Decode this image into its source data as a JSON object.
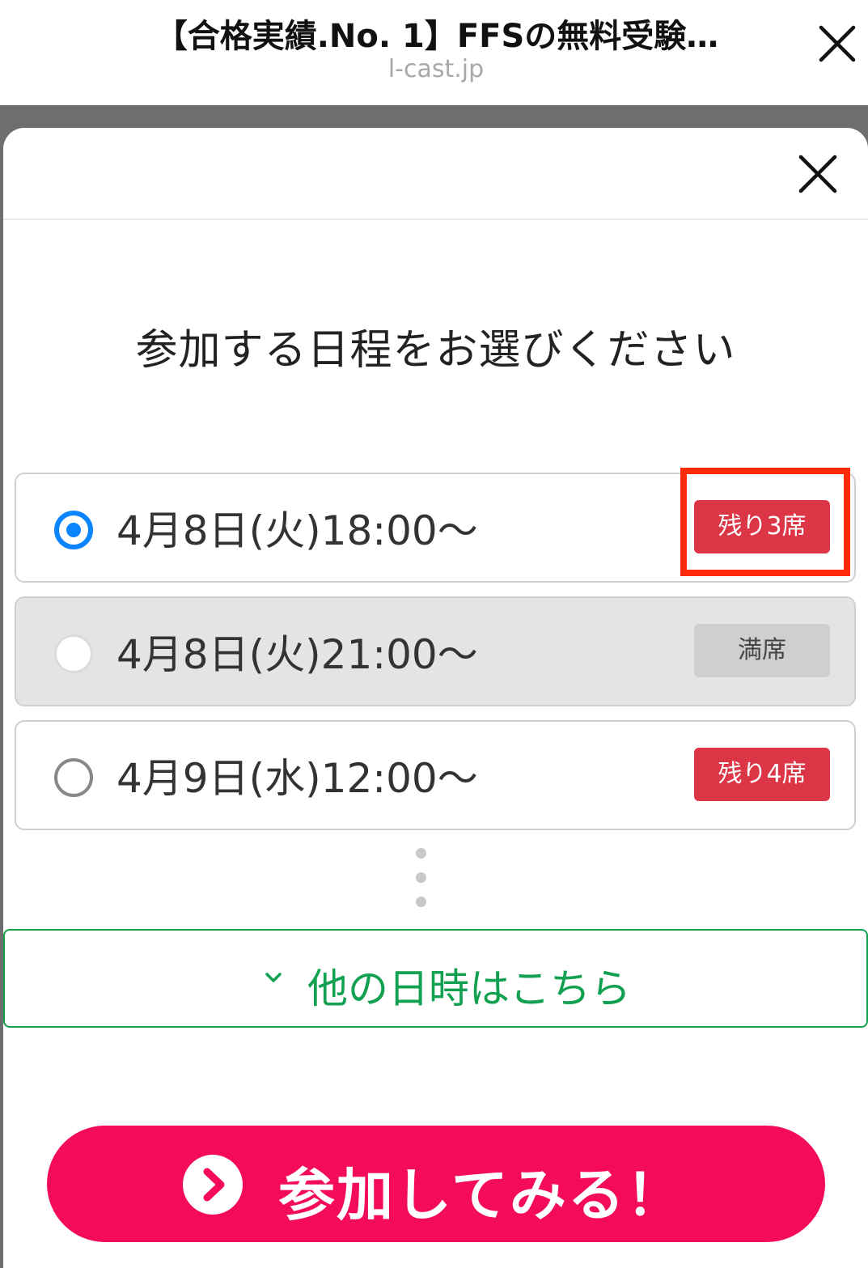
{
  "browser": {
    "title": "【合格実績.No. 1】FFSの無料受験…",
    "domain": "l-cast.jp"
  },
  "modal": {
    "heading": "参加する日程をお選びください",
    "slots": [
      {
        "label": "4月8日(火)18:00〜",
        "badge": "残り3席",
        "state": "selected"
      },
      {
        "label": "4月8日(火)21:00〜",
        "badge": "満席",
        "state": "full"
      },
      {
        "label": "4月9日(水)12:00〜",
        "badge": "残り4席",
        "state": "available"
      }
    ],
    "more_dates_label": "他の日時はこちら",
    "cta_label": "参加してみる！"
  },
  "colors": {
    "accent_blue": "#0a84ff",
    "badge_red": "#dc3545",
    "highlight_red": "#ff2a0a",
    "link_green": "#12a150",
    "cta_pink": "#f40c59"
  }
}
